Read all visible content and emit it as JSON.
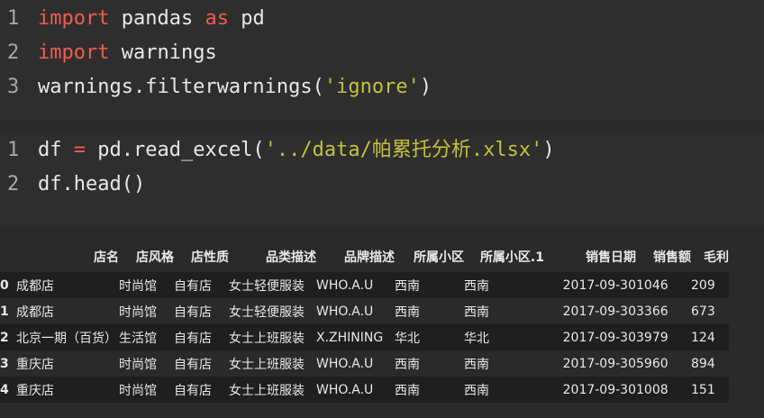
{
  "cell1": {
    "lines": [
      {
        "num": "1",
        "tokens": [
          {
            "t": "import",
            "c": "kw"
          },
          {
            "t": " pandas ",
            "c": "tx"
          },
          {
            "t": "as",
            "c": "kw"
          },
          {
            "t": " pd",
            "c": "tx"
          }
        ]
      },
      {
        "num": "2",
        "tokens": [
          {
            "t": "import",
            "c": "kw"
          },
          {
            "t": " warnings",
            "c": "tx"
          }
        ]
      },
      {
        "num": "3",
        "tokens": [
          {
            "t": "warnings.filterwarnings(",
            "c": "tx"
          },
          {
            "t": "'ignore'",
            "c": "str"
          },
          {
            "t": ")",
            "c": "tx"
          }
        ]
      }
    ]
  },
  "cell2": {
    "lines": [
      {
        "num": "1",
        "tokens": [
          {
            "t": "df ",
            "c": "tx"
          },
          {
            "t": "=",
            "c": "op"
          },
          {
            "t": " pd.read_excel(",
            "c": "tx"
          },
          {
            "t": "'../data/帕累托分析.xlsx'",
            "c": "str"
          },
          {
            "t": ")",
            "c": "tx"
          }
        ]
      },
      {
        "num": "2",
        "tokens": [
          {
            "t": "df.head()",
            "c": "tx"
          }
        ]
      }
    ]
  },
  "dataframe": {
    "columns": [
      "店名",
      "店风格",
      "店性质",
      "品类描述",
      "品牌描述",
      "所属小区",
      "所属小区.1",
      "销售日期",
      "销售额",
      "毛利"
    ],
    "rows": [
      {
        "index": "0",
        "cells": [
          "成都店",
          "时尚馆",
          "自有店",
          "女士轻便服装",
          "WHO.A.U",
          "西南",
          "西南",
          "2017-09-30",
          "1046",
          "209"
        ]
      },
      {
        "index": "1",
        "cells": [
          "成都店",
          "时尚馆",
          "自有店",
          "女士轻便服装",
          "WHO.A.U",
          "西南",
          "西南",
          "2017-09-30",
          "3366",
          "673"
        ]
      },
      {
        "index": "2",
        "cells": [
          "北京一期（百货）",
          "生活馆",
          "自有店",
          "女士上班服装",
          "X.ZHINING",
          "华北",
          "华北",
          "2017-09-30",
          "3979",
          "124"
        ]
      },
      {
        "index": "3",
        "cells": [
          "重庆店",
          "时尚馆",
          "自有店",
          "女士上班服装",
          "WHO.A.U",
          "西南",
          "西南",
          "2017-09-30",
          "5960",
          "894"
        ]
      },
      {
        "index": "4",
        "cells": [
          "重庆店",
          "时尚馆",
          "自有店",
          "女士上班服装",
          "WHO.A.U",
          "西南",
          "西南",
          "2017-09-30",
          "1008",
          "151"
        ]
      }
    ]
  }
}
